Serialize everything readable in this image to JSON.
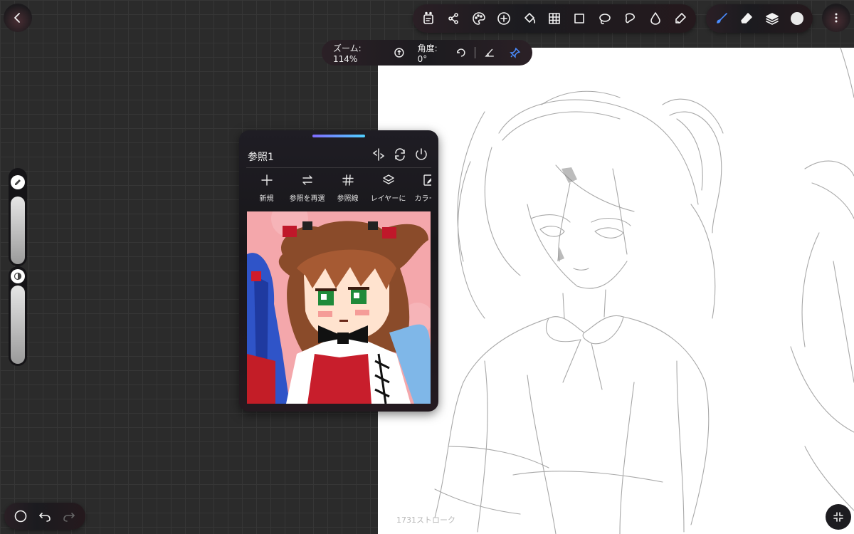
{
  "toolbar": {
    "icons": [
      "stamp-icon",
      "share-icon",
      "palette-icon",
      "add-icon",
      "fill-bucket-icon",
      "grid-icon",
      "transform-icon",
      "lasso-icon",
      "lasso-fill-icon",
      "blur-icon",
      "smudge-icon"
    ],
    "tools": [
      "brush-icon",
      "eraser-icon",
      "layers-icon",
      "color-swatch"
    ],
    "current_color": "#e9e9e9"
  },
  "info_bar": {
    "zoom_text": "ズーム: 114%",
    "angle_text": "角度: 0°"
  },
  "reference_panel": {
    "title": "参照1",
    "tools": [
      {
        "icon": "plus-icon",
        "label": "新規"
      },
      {
        "icon": "swap-icon",
        "label": "参照を再選"
      },
      {
        "icon": "hash-icon",
        "label": "参照線"
      },
      {
        "icon": "layers-icon",
        "label": "レイヤーに"
      },
      {
        "icon": "edit-icon",
        "label": "カラーを"
      }
    ]
  },
  "canvas": {
    "stroke_count": "1731ストローク"
  },
  "colors": {
    "accent_gradient_start": "#7f6bff",
    "accent_gradient_end": "#4fd0ff",
    "brush_blue": "#4a8cff"
  },
  "sliders": {
    "size_level": 0.72,
    "opacity_level": 0.82
  }
}
